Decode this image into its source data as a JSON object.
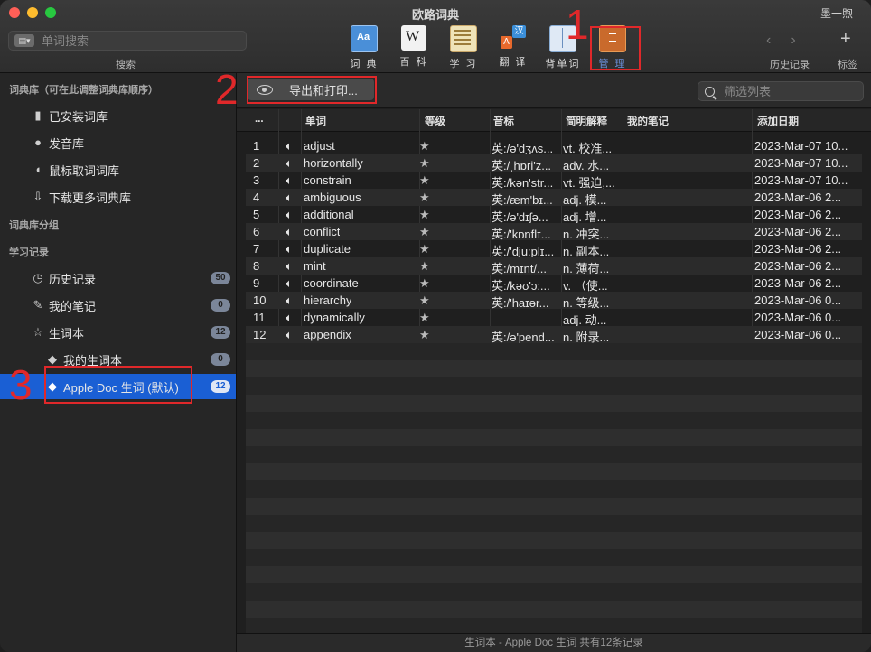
{
  "window": {
    "title": "欧路词典",
    "user": "墨一煦"
  },
  "toolbar": {
    "search_placeholder": "单词搜索",
    "search_caption": "搜索",
    "tools": [
      {
        "label": "词 典",
        "icon": "dictionary-icon"
      },
      {
        "label": "百 科",
        "icon": "wikipedia-icon"
      },
      {
        "label": "学 习",
        "icon": "study-icon"
      },
      {
        "label": "翻 译",
        "icon": "translate-icon"
      },
      {
        "label": "背单词",
        "icon": "flashcard-icon"
      },
      {
        "label": "管 理",
        "icon": "manage-icon"
      }
    ],
    "history_caption": "历史记录",
    "tag_caption": "标签"
  },
  "annotations": {
    "a1": "1",
    "a2": "2",
    "a3": "3"
  },
  "sidebar": {
    "section_library": "词典库（可在此调整词典库顺序）",
    "library_items": [
      {
        "label": "已安装词库",
        "icon": "book-icon"
      },
      {
        "label": "发音库",
        "icon": "speech-bubble-icon"
      },
      {
        "label": "鼠标取词词库",
        "icon": "mouse-icon"
      },
      {
        "label": "下载更多词典库",
        "icon": "download-arrow-icon"
      }
    ],
    "section_groups": "词典库分组",
    "section_study": "学习记录",
    "study_items": [
      {
        "label": "历史记录",
        "icon": "clock-icon",
        "badge": "50"
      },
      {
        "label": "我的笔记",
        "icon": "pencil-icon",
        "badge": "0"
      },
      {
        "label": "生词本",
        "icon": "star-icon",
        "badge": "12"
      },
      {
        "label": "我的生词本",
        "icon": "tag-icon",
        "badge": "0"
      },
      {
        "label": "Apple Doc 生词 (默认)",
        "icon": "tag-icon",
        "badge": "12"
      }
    ]
  },
  "main": {
    "export_label": "导出和打印...",
    "filter_placeholder": "筛选列表",
    "columns": [
      "...",
      "单词",
      "等级",
      "音标",
      "简明解释",
      "我的笔记",
      "添加日期"
    ],
    "rows": [
      {
        "n": "1",
        "word": "adjust",
        "star": "★",
        "phonetic": "英:/ə'dʒʌs...",
        "meaning": "vt. 校准...",
        "date": "2023-Mar-07 10..."
      },
      {
        "n": "2",
        "word": "horizontally",
        "star": "★",
        "phonetic": "英:/ˌhɒri'z...",
        "meaning": "adv. 水...",
        "date": "2023-Mar-07 10..."
      },
      {
        "n": "3",
        "word": "constrain",
        "star": "★",
        "phonetic": "英:/kən'str...",
        "meaning": "vt. 强迫,...",
        "date": "2023-Mar-07 10..."
      },
      {
        "n": "4",
        "word": "ambiguous",
        "star": "★",
        "phonetic": "英:/æm'bɪ...",
        "meaning": "adj. 模...",
        "date": "2023-Mar-06 2..."
      },
      {
        "n": "5",
        "word": "additional",
        "star": "★",
        "phonetic": "英:/ə'dɪʃə...",
        "meaning": "adj. 增...",
        "date": "2023-Mar-06 2..."
      },
      {
        "n": "6",
        "word": "conflict",
        "star": "★",
        "phonetic": "英:/'kɒnflɪ...",
        "meaning": "n. 冲突...",
        "date": "2023-Mar-06 2..."
      },
      {
        "n": "7",
        "word": "duplicate",
        "star": "★",
        "phonetic": "英:/'dju:plɪ...",
        "meaning": "n. 副本...",
        "date": "2023-Mar-06 2..."
      },
      {
        "n": "8",
        "word": "mint",
        "star": "★",
        "phonetic": "英:/mɪnt/...",
        "meaning": "n. 薄荷...",
        "date": "2023-Mar-06 2..."
      },
      {
        "n": "9",
        "word": "coordinate",
        "star": "★",
        "phonetic": "英:/kəʊ'ɔ:...",
        "meaning": "v. （使...",
        "date": "2023-Mar-06 2..."
      },
      {
        "n": "10",
        "word": "hierarchy",
        "star": "★",
        "phonetic": "英:/'haɪər...",
        "meaning": "n. 等级...",
        "date": "2023-Mar-06 0..."
      },
      {
        "n": "11",
        "word": "dynamically",
        "star": "★",
        "phonetic": "",
        "meaning": "adj. 动...",
        "date": "2023-Mar-06 0..."
      },
      {
        "n": "12",
        "word": "appendix",
        "star": "★",
        "phonetic": "英:/ə'pend...",
        "meaning": "n. 附录...",
        "date": "2023-Mar-06 0..."
      }
    ],
    "status": "生词本 - Apple Doc 生词  共有12条记录"
  }
}
